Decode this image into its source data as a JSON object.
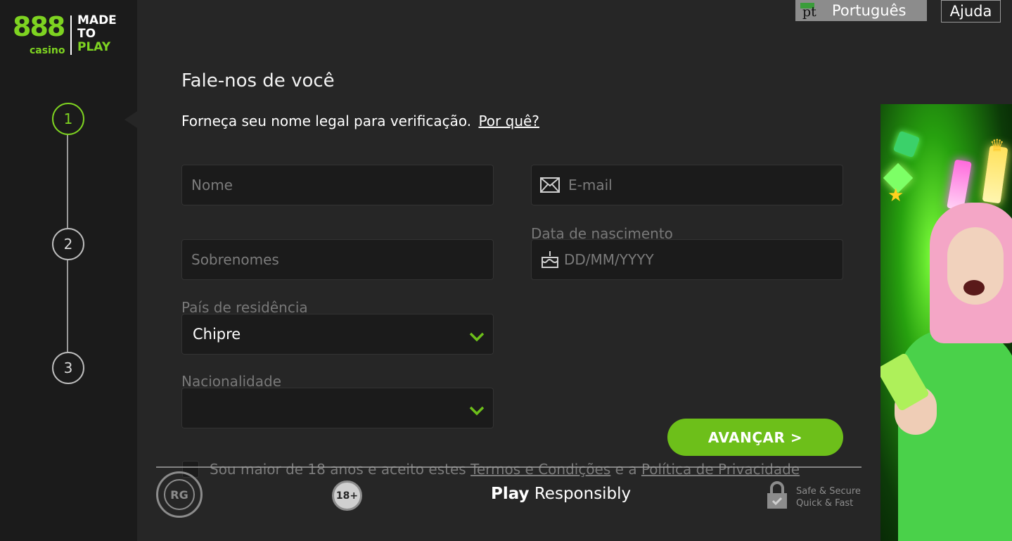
{
  "brand": {
    "logo_number": "888",
    "logo_sub": "casino",
    "tagline_line1": "MADE",
    "tagline_line2": "TO",
    "tagline_line3": "PLAY",
    "brand_color": "#7ed321"
  },
  "stepper": {
    "steps": [
      "1",
      "2",
      "3"
    ],
    "active_step": 1
  },
  "topbar": {
    "language_code": "pt",
    "language_label": "Português",
    "help_label": "Ajuda"
  },
  "form": {
    "title": "Fale-nos de você",
    "subtitle": "Forneça seu nome legal para verificação.",
    "why_link": "Por quê?",
    "first_name_placeholder": "Nome",
    "email_placeholder": "E-mail",
    "surname_placeholder": "Sobrenomes",
    "dob_label": "Data de nascimento",
    "dob_placeholder": "DD/MM/YYYY",
    "country_label": "País de residência",
    "country_value": "Chipre",
    "nationality_label": "Nacionalidade",
    "nationality_value": "",
    "submit_label": "AVANÇAR >",
    "terms_prefix": "Sou maior de 18 anos e aceito estes",
    "terms_link": "Termos e Condições",
    "terms_middle": "e a",
    "privacy_link": "Política de Privacidade",
    "accent_color": "#6dbf1a"
  },
  "footer": {
    "rg_badge": "RG",
    "age_badge": "18+",
    "play_bold": "Play",
    "play_rest": "Responsibly",
    "secure_line1": "Safe & Secure",
    "secure_line2": "Quick & Fast"
  },
  "icons": {
    "email": "envelope-icon",
    "dob": "cake-icon",
    "select": "chevron-down-icon",
    "lock": "lock-icon"
  }
}
